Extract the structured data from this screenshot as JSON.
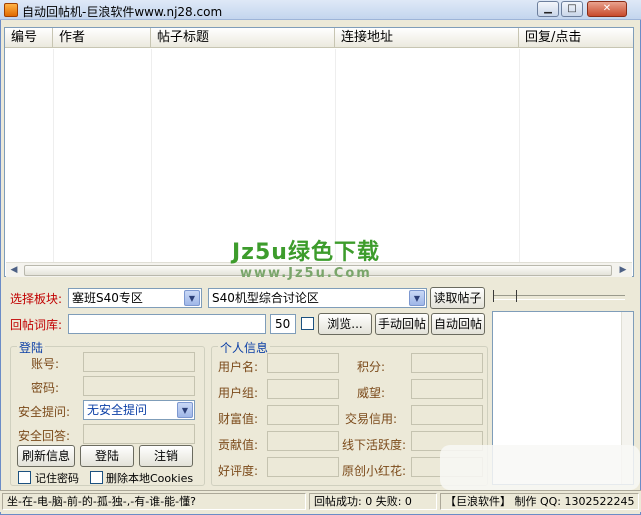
{
  "window": {
    "title": "自动回帖机-巨浪软件www.nj28.com",
    "controls": {
      "minimize": "▁",
      "maximize": "□",
      "close": "✕"
    }
  },
  "list": {
    "columns": [
      "编号",
      "作者",
      "帖子标题",
      "连接地址",
      "回复/点击"
    ],
    "rows": [],
    "watermark": "Jz5u绿色下载",
    "watermark_url": "www.Jz5u.Com"
  },
  "forum": {
    "board_label": "选择板块:",
    "board_value": "塞班S40专区",
    "subforum_value": "S40机型综合讨论区",
    "read_button": "读取帖子"
  },
  "reply": {
    "library_label": "回帖词库:",
    "library_value": "",
    "count": "50",
    "browse_button": "浏览...",
    "manual_button": "手动回帖",
    "auto_button": "自动回帖"
  },
  "login": {
    "group_title": "登陆",
    "account_label": "账号:",
    "account_value": "",
    "password_label": "密码:",
    "password_value": "",
    "security_q_label": "安全提问:",
    "security_q_value": "无安全提问",
    "security_a_label": "安全回答:",
    "security_a_value": "",
    "refresh_button": "刷新信息",
    "login_button": "登陆",
    "logout_button": "注销",
    "remember_label": "记住密码",
    "clear_cookies_label": "删除本地Cookies"
  },
  "profile": {
    "group_title": "个人信息",
    "fields_left": [
      {
        "label": "用户名:",
        "value": ""
      },
      {
        "label": "用户组:",
        "value": ""
      },
      {
        "label": "财富值:",
        "value": ""
      },
      {
        "label": "贡献值:",
        "value": ""
      },
      {
        "label": "好评度:",
        "value": ""
      }
    ],
    "fields_right": [
      {
        "label": "积分:",
        "value": ""
      },
      {
        "label": "威望:",
        "value": ""
      },
      {
        "label": "交易信用:",
        "value": ""
      },
      {
        "label": "线下活跃度:",
        "value": ""
      },
      {
        "label": "原创小红花:",
        "value": ""
      }
    ]
  },
  "status": {
    "motto": "坐-在-电-脑-前-的-孤-独-,-有-谁-能-懂?",
    "result": "回帖成功: 0 失败: 0",
    "brand": "【巨浪软件】 制作 QQ: 1302522245"
  }
}
